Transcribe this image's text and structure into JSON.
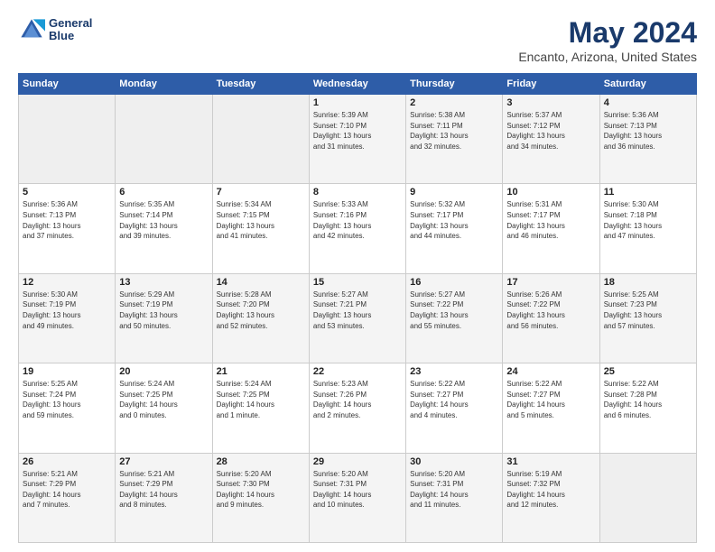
{
  "header": {
    "logo_line1": "General",
    "logo_line2": "Blue",
    "title": "May 2024",
    "subtitle": "Encanto, Arizona, United States"
  },
  "weekdays": [
    "Sunday",
    "Monday",
    "Tuesday",
    "Wednesday",
    "Thursday",
    "Friday",
    "Saturday"
  ],
  "weeks": [
    [
      {
        "day": "",
        "info": ""
      },
      {
        "day": "",
        "info": ""
      },
      {
        "day": "",
        "info": ""
      },
      {
        "day": "1",
        "info": "Sunrise: 5:39 AM\nSunset: 7:10 PM\nDaylight: 13 hours\nand 31 minutes."
      },
      {
        "day": "2",
        "info": "Sunrise: 5:38 AM\nSunset: 7:11 PM\nDaylight: 13 hours\nand 32 minutes."
      },
      {
        "day": "3",
        "info": "Sunrise: 5:37 AM\nSunset: 7:12 PM\nDaylight: 13 hours\nand 34 minutes."
      },
      {
        "day": "4",
        "info": "Sunrise: 5:36 AM\nSunset: 7:13 PM\nDaylight: 13 hours\nand 36 minutes."
      }
    ],
    [
      {
        "day": "5",
        "info": "Sunrise: 5:36 AM\nSunset: 7:13 PM\nDaylight: 13 hours\nand 37 minutes."
      },
      {
        "day": "6",
        "info": "Sunrise: 5:35 AM\nSunset: 7:14 PM\nDaylight: 13 hours\nand 39 minutes."
      },
      {
        "day": "7",
        "info": "Sunrise: 5:34 AM\nSunset: 7:15 PM\nDaylight: 13 hours\nand 41 minutes."
      },
      {
        "day": "8",
        "info": "Sunrise: 5:33 AM\nSunset: 7:16 PM\nDaylight: 13 hours\nand 42 minutes."
      },
      {
        "day": "9",
        "info": "Sunrise: 5:32 AM\nSunset: 7:17 PM\nDaylight: 13 hours\nand 44 minutes."
      },
      {
        "day": "10",
        "info": "Sunrise: 5:31 AM\nSunset: 7:17 PM\nDaylight: 13 hours\nand 46 minutes."
      },
      {
        "day": "11",
        "info": "Sunrise: 5:30 AM\nSunset: 7:18 PM\nDaylight: 13 hours\nand 47 minutes."
      }
    ],
    [
      {
        "day": "12",
        "info": "Sunrise: 5:30 AM\nSunset: 7:19 PM\nDaylight: 13 hours\nand 49 minutes."
      },
      {
        "day": "13",
        "info": "Sunrise: 5:29 AM\nSunset: 7:19 PM\nDaylight: 13 hours\nand 50 minutes."
      },
      {
        "day": "14",
        "info": "Sunrise: 5:28 AM\nSunset: 7:20 PM\nDaylight: 13 hours\nand 52 minutes."
      },
      {
        "day": "15",
        "info": "Sunrise: 5:27 AM\nSunset: 7:21 PM\nDaylight: 13 hours\nand 53 minutes."
      },
      {
        "day": "16",
        "info": "Sunrise: 5:27 AM\nSunset: 7:22 PM\nDaylight: 13 hours\nand 55 minutes."
      },
      {
        "day": "17",
        "info": "Sunrise: 5:26 AM\nSunset: 7:22 PM\nDaylight: 13 hours\nand 56 minutes."
      },
      {
        "day": "18",
        "info": "Sunrise: 5:25 AM\nSunset: 7:23 PM\nDaylight: 13 hours\nand 57 minutes."
      }
    ],
    [
      {
        "day": "19",
        "info": "Sunrise: 5:25 AM\nSunset: 7:24 PM\nDaylight: 13 hours\nand 59 minutes."
      },
      {
        "day": "20",
        "info": "Sunrise: 5:24 AM\nSunset: 7:25 PM\nDaylight: 14 hours\nand 0 minutes."
      },
      {
        "day": "21",
        "info": "Sunrise: 5:24 AM\nSunset: 7:25 PM\nDaylight: 14 hours\nand 1 minute."
      },
      {
        "day": "22",
        "info": "Sunrise: 5:23 AM\nSunset: 7:26 PM\nDaylight: 14 hours\nand 2 minutes."
      },
      {
        "day": "23",
        "info": "Sunrise: 5:22 AM\nSunset: 7:27 PM\nDaylight: 14 hours\nand 4 minutes."
      },
      {
        "day": "24",
        "info": "Sunrise: 5:22 AM\nSunset: 7:27 PM\nDaylight: 14 hours\nand 5 minutes."
      },
      {
        "day": "25",
        "info": "Sunrise: 5:22 AM\nSunset: 7:28 PM\nDaylight: 14 hours\nand 6 minutes."
      }
    ],
    [
      {
        "day": "26",
        "info": "Sunrise: 5:21 AM\nSunset: 7:29 PM\nDaylight: 14 hours\nand 7 minutes."
      },
      {
        "day": "27",
        "info": "Sunrise: 5:21 AM\nSunset: 7:29 PM\nDaylight: 14 hours\nand 8 minutes."
      },
      {
        "day": "28",
        "info": "Sunrise: 5:20 AM\nSunset: 7:30 PM\nDaylight: 14 hours\nand 9 minutes."
      },
      {
        "day": "29",
        "info": "Sunrise: 5:20 AM\nSunset: 7:31 PM\nDaylight: 14 hours\nand 10 minutes."
      },
      {
        "day": "30",
        "info": "Sunrise: 5:20 AM\nSunset: 7:31 PM\nDaylight: 14 hours\nand 11 minutes."
      },
      {
        "day": "31",
        "info": "Sunrise: 5:19 AM\nSunset: 7:32 PM\nDaylight: 14 hours\nand 12 minutes."
      },
      {
        "day": "",
        "info": ""
      }
    ]
  ]
}
